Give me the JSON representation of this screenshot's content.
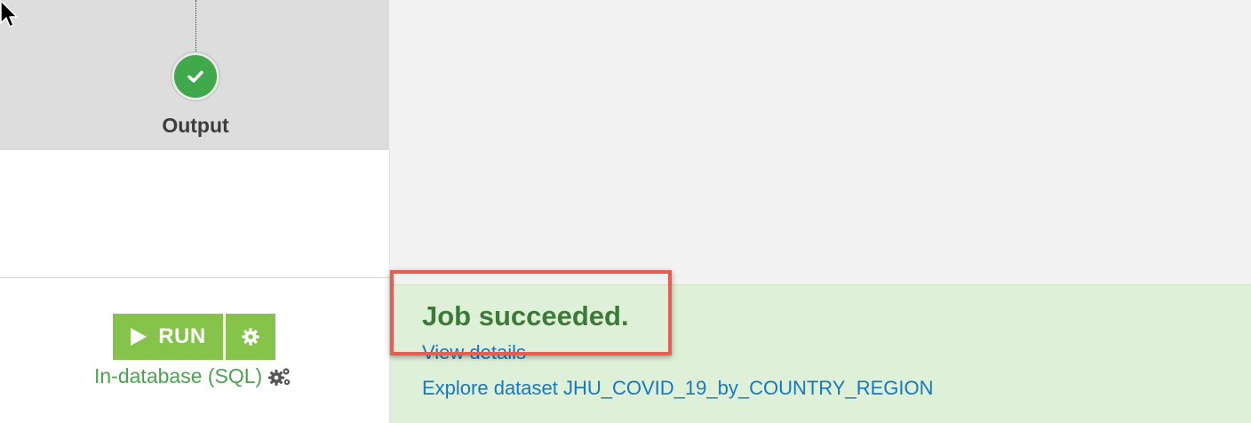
{
  "flow": {
    "output_label": "Output",
    "output_status_icon": "check-circle-icon",
    "status_color": "#3fa94b"
  },
  "recipe": {
    "run_label": "RUN",
    "run_icon": "play-icon",
    "settings_icon": "gear-icon",
    "engine_label": "In-database (SQL)",
    "engine_icon": "gears-icon",
    "accent_color": "#86c34a"
  },
  "job": {
    "status_title": "Job succeeded.",
    "view_details_label": "View details",
    "explore_label": "Explore dataset JHU_COVID_19_by_COUNTRY_REGION",
    "success_bg": "#dff0d8",
    "link_color": "#1579c0"
  },
  "annotation": {
    "highlight_color": "#ec5b4f"
  }
}
